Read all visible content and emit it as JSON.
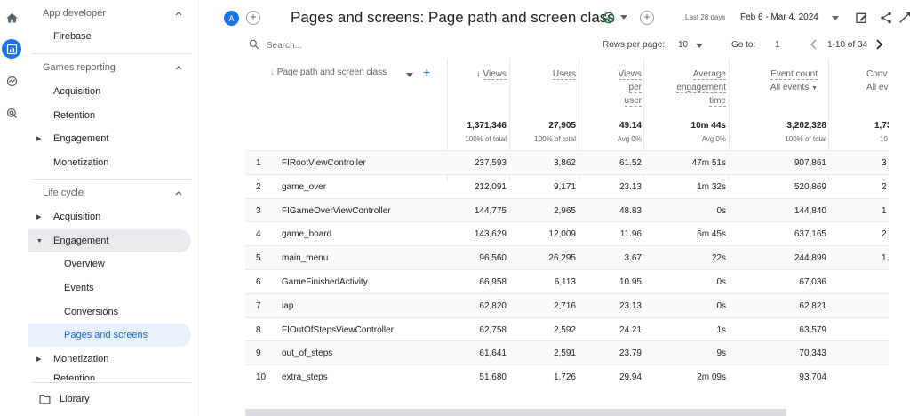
{
  "rail": {
    "icons": [
      "home-icon",
      "reports-icon",
      "explore-icon",
      "advertising-icon"
    ]
  },
  "sidebar": {
    "sections": [
      {
        "label": "App developer"
      },
      {
        "label": "Games reporting"
      },
      {
        "label": "Life cycle"
      }
    ],
    "items": {
      "firebase": "Firebase",
      "acquisition1": "Acquisition",
      "retention1": "Retention",
      "engagement1": "Engagement",
      "monetization1": "Monetization",
      "acquisition2": "Acquisition",
      "engagement2": "Engagement",
      "overview": "Overview",
      "events": "Events",
      "conversions": "Conversions",
      "pages": "Pages and screens",
      "monetization2": "Monetization",
      "retention2": "Retention",
      "library": "Library"
    }
  },
  "header": {
    "avatar": "A",
    "title": "Pages and screens: Page path and screen class",
    "date_label": "Last 28 days",
    "date_range": "Feb 6 - Mar 4, 2024"
  },
  "toolbar": {
    "search_placeholder": "Search...",
    "rows_label": "Rows per page:",
    "rows_value": "10",
    "goto_label": "Go to:",
    "goto_value": "1",
    "range": "1-10 of 34"
  },
  "table": {
    "dimension_header": "Page path and screen class",
    "headers": {
      "views": "Views",
      "users": "Users",
      "vpu1": "Views",
      "vpu2": "per",
      "vpu3": "user",
      "aet1": "Average",
      "aet2": "engagement",
      "aet3": "time",
      "event1": "Event count",
      "event2": "All events",
      "conv1": "Conv",
      "conv2": "All ev"
    },
    "totals": {
      "views": "1,371,346",
      "users": "27,905",
      "vpu": "49.14",
      "aet": "10m 44s",
      "events": "3,202,328",
      "conv": "1,73"
    },
    "subtotals": {
      "views": "100% of total",
      "users": "100% of total",
      "vpu": "Avg 0%",
      "aet": "Avg 0%",
      "events": "100% of total",
      "conv": "10"
    },
    "rows": [
      {
        "n": "1",
        "name": "FIRootViewController",
        "views": "237,593",
        "users": "3,862",
        "vpu": "61.52",
        "aet": "47m 51s",
        "events": "907,861",
        "conv": "3"
      },
      {
        "n": "2",
        "name": "game_over",
        "views": "212,091",
        "users": "9,171",
        "vpu": "23.13",
        "aet": "1m 32s",
        "events": "520,869",
        "conv": "2"
      },
      {
        "n": "3",
        "name": "FIGameOverViewController",
        "views": "144,775",
        "users": "2,965",
        "vpu": "48.83",
        "aet": "0s",
        "events": "144,840",
        "conv": "1"
      },
      {
        "n": "4",
        "name": "game_board",
        "views": "143,629",
        "users": "12,009",
        "vpu": "11.96",
        "aet": "6m 45s",
        "events": "637,165",
        "conv": "2"
      },
      {
        "n": "5",
        "name": "main_menu",
        "views": "96,560",
        "users": "26,295",
        "vpu": "3.67",
        "aet": "22s",
        "events": "244,899",
        "conv": "1"
      },
      {
        "n": "6",
        "name": "GameFinishedActivity",
        "views": "66,958",
        "users": "6,113",
        "vpu": "10.95",
        "aet": "0s",
        "events": "67,036",
        "conv": ""
      },
      {
        "n": "7",
        "name": "iap",
        "views": "62,820",
        "users": "2,716",
        "vpu": "23.13",
        "aet": "0s",
        "events": "62,821",
        "conv": ""
      },
      {
        "n": "8",
        "name": "FIOutOfStepsViewController",
        "views": "62,758",
        "users": "2,592",
        "vpu": "24.21",
        "aet": "1s",
        "events": "63,579",
        "conv": ""
      },
      {
        "n": "9",
        "name": "out_of_steps",
        "views": "61,641",
        "users": "2,591",
        "vpu": "23.79",
        "aet": "9s",
        "events": "70,343",
        "conv": ""
      },
      {
        "n": "10",
        "name": "extra_steps",
        "views": "51,680",
        "users": "1,726",
        "vpu": "29.94",
        "aet": "2m 09s",
        "events": "93,704",
        "conv": ""
      }
    ]
  },
  "colors": {
    "accent": "#1a73e8",
    "selected_bg": "#e8f0fe",
    "selected_text": "#1967d2",
    "success": "#188038"
  }
}
